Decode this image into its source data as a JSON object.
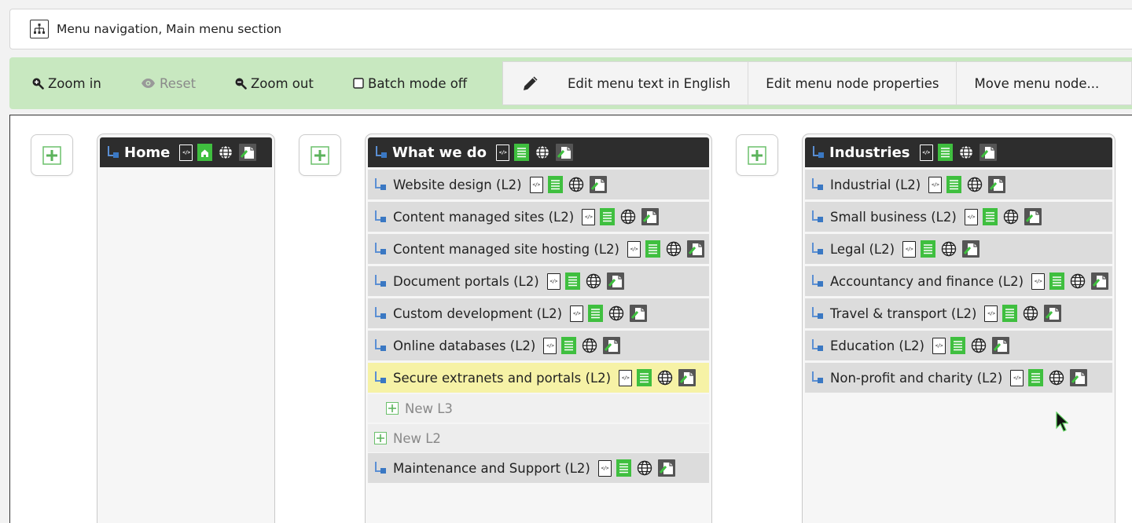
{
  "title_bar": {
    "label": "Menu navigation, Main menu section",
    "icon": "sitemap-icon"
  },
  "toolbar": {
    "zoom_in": "Zoom in",
    "reset": "Reset",
    "zoom_out": "Zoom out",
    "batch_mode": "Batch mode off",
    "edit_text": "Edit menu text in English",
    "edit_props": "Edit menu node properties",
    "move_node": "Move menu node..."
  },
  "colors": {
    "toolbar_bg": "#c8e8c0",
    "header_bg": "#2d2d2d",
    "highlight": "#f6f2a6",
    "accent_green": "#3fbf3f",
    "node_blue": "#3a78c3"
  },
  "columns": [
    {
      "title": "Home",
      "items": []
    },
    {
      "title": "What we do",
      "items": [
        "Website design (L2)",
        "Content managed sites (L2)",
        "Content managed site hosting (L2)",
        "Document portals (L2)",
        "Custom development (L2)",
        "Online databases (L2)",
        "Secure extranets and portals (L2)",
        "New L3",
        "New L2",
        "Maintenance and Support (L2)"
      ]
    },
    {
      "title": "Industries",
      "items": [
        "Industrial (L2)",
        "Small business (L2)",
        "Legal (L2)",
        "Accountancy and finance (L2)",
        "Travel & transport (L2)",
        "Education (L2)",
        "Non-profit and charity (L2)"
      ]
    }
  ]
}
